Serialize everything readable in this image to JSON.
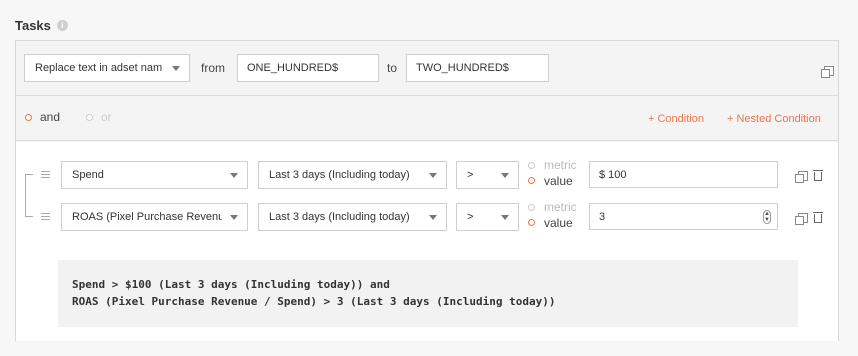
{
  "section": {
    "title": "Tasks",
    "info_icon": "i"
  },
  "task": {
    "action_label": "Replace text in adset nam",
    "from_label": "from",
    "from_value": "ONE_HUNDRED$",
    "to_label": "to",
    "to_value": "TWO_HUNDRED$"
  },
  "logic": {
    "and_label": "and",
    "or_label": "or",
    "selected": "and",
    "add_condition": "+ Condition",
    "add_nested_condition": "+ Nested Condition"
  },
  "conditions": [
    {
      "metric": "Spend",
      "period": "Last 3 days (Including today)",
      "operator": ">",
      "metric_option": "metric",
      "value_option": "value",
      "value": "$ 100"
    },
    {
      "metric": "ROAS (Pixel Purchase Revenue",
      "period": "Last 3 days (Including today)",
      "operator": ">",
      "metric_option": "metric",
      "value_option": "value",
      "value": "3"
    }
  ],
  "summary": {
    "line1": "Spend > $100 (Last 3 days (Including today)) and",
    "line2": "ROAS (Pixel Purchase Revenue / Spend) > 3 (Last 3 days (Including today))"
  },
  "colors": {
    "accent": "#e8774a"
  },
  "icons": [
    "info-icon",
    "copy-icon",
    "drag-handle-icon",
    "trash-icon",
    "chevron-down-icon",
    "stepper-icon"
  ]
}
